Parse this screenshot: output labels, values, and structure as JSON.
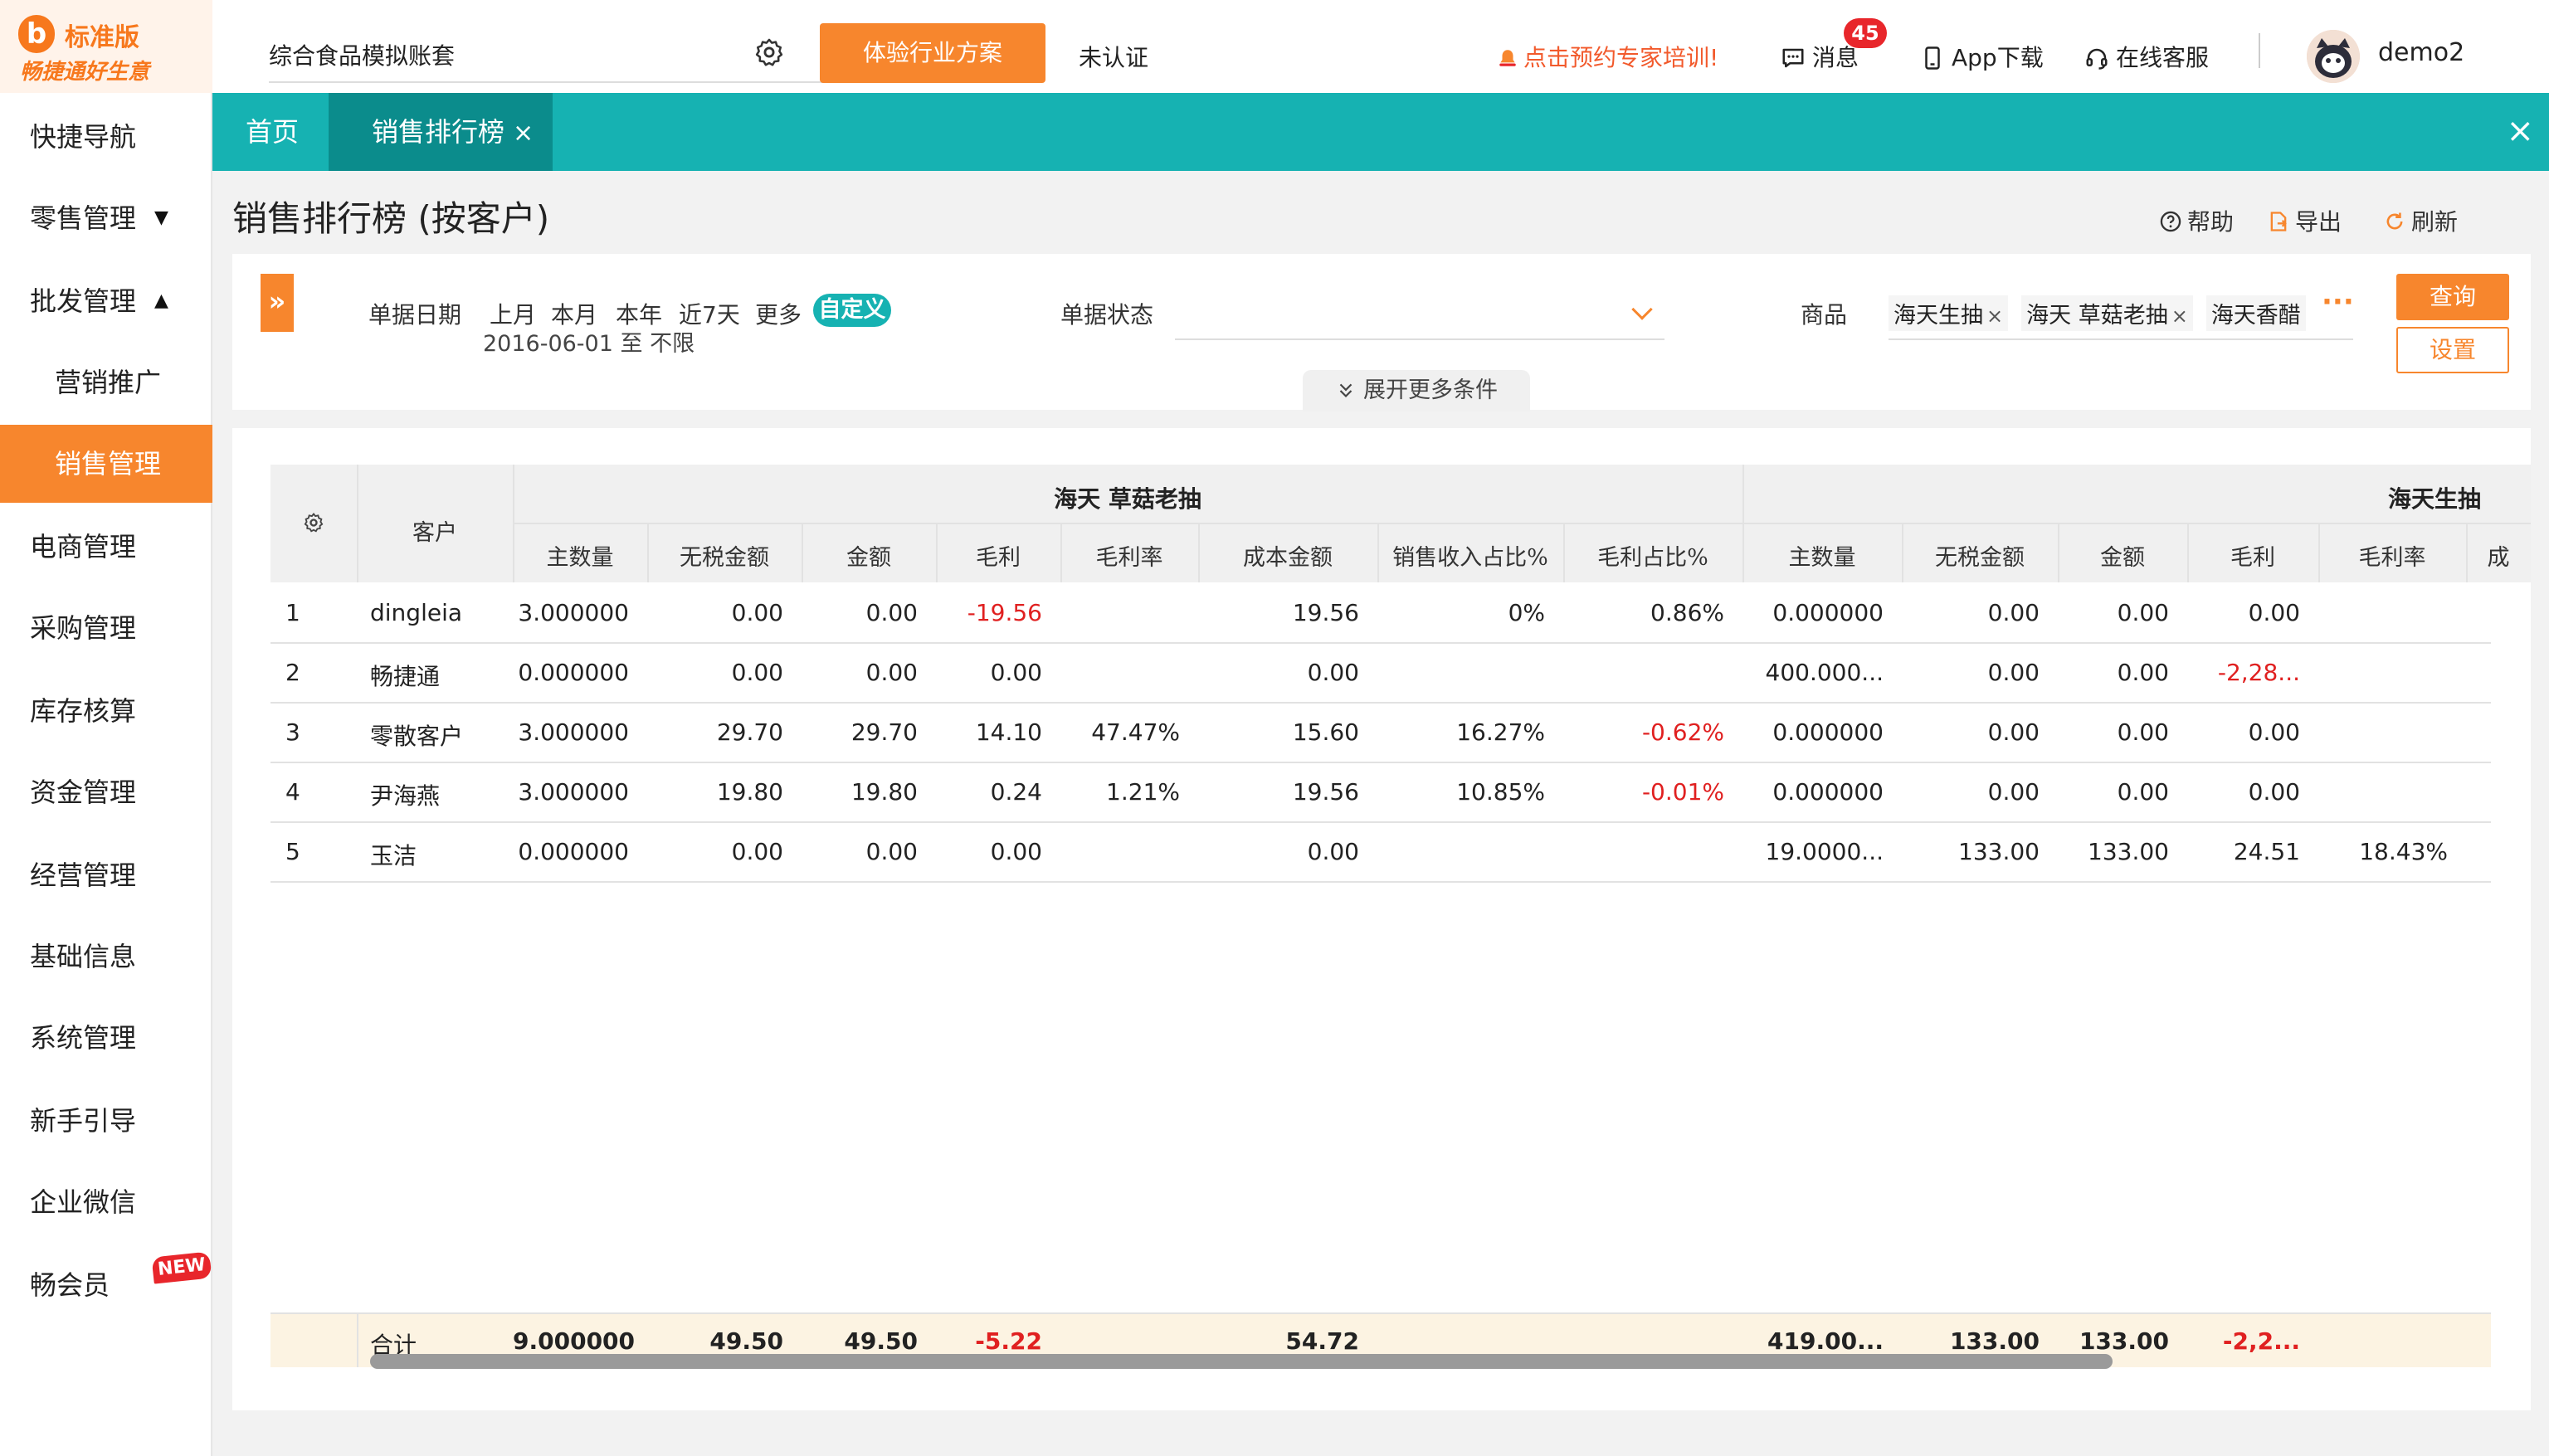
{
  "brand": {
    "logo_letter": "b",
    "edition": "标准版",
    "slogan": "畅捷通好生意"
  },
  "sidebar": {
    "items": [
      {
        "label": "快捷导航",
        "caret": ""
      },
      {
        "label": "零售管理",
        "caret": "▼"
      },
      {
        "label": "批发管理",
        "caret": "▲"
      },
      {
        "label": "营销推广",
        "caret": ""
      },
      {
        "label": "销售管理",
        "caret": ""
      },
      {
        "label": "电商管理",
        "caret": ""
      },
      {
        "label": "采购管理",
        "caret": ""
      },
      {
        "label": "库存核算",
        "caret": ""
      },
      {
        "label": "资金管理",
        "caret": ""
      },
      {
        "label": "经营管理",
        "caret": ""
      },
      {
        "label": "基础信息",
        "caret": ""
      },
      {
        "label": "系统管理",
        "caret": ""
      },
      {
        "label": "新手引导",
        "caret": ""
      },
      {
        "label": "企业微信",
        "caret": ""
      },
      {
        "label": "畅会员",
        "caret": ""
      }
    ],
    "new_badge": "NEW"
  },
  "header": {
    "account": "综合食品模拟账套",
    "trial_button": "体验行业方案",
    "verify_status": "未认证",
    "expert_link": "点击预约专家培训!",
    "messages_label": "消息",
    "messages_count": "45",
    "app_download": "App下载",
    "online_service": "在线客服",
    "username": "demo2"
  },
  "tabs": {
    "home": "首页",
    "current": "销售排行榜",
    "close_symbol": "×",
    "close_all": "×"
  },
  "page": {
    "title": "销售排行榜 (按客户)",
    "help": "帮助",
    "export": "导出",
    "refresh": "刷新"
  },
  "filters": {
    "toggle": "»",
    "date_label": "单据日期",
    "quick_dates": [
      "上月",
      "本月",
      "本年",
      "近7天",
      "更多"
    ],
    "custom": "自定义",
    "date_range": "2016-06-01 至 不限",
    "status_label": "单据状态",
    "status_value": "",
    "product_label": "商品",
    "product_chips": [
      "海天生抽",
      "海天 草菇老抽",
      "海天香醋"
    ],
    "more_dots": "···",
    "query": "查询",
    "settings": "设置",
    "expand_more": "展开更多条件"
  },
  "table": {
    "customer_header": "客户",
    "groups": [
      "海天 草菇老抽",
      "海天生抽"
    ],
    "columns_g1": [
      "主数量",
      "无税金额",
      "金额",
      "毛利",
      "毛利率",
      "成本金额",
      "销售收入占比%",
      "毛利占比%"
    ],
    "columns_g2": [
      "主数量",
      "无税金额",
      "金额",
      "毛利",
      "毛利率",
      "成"
    ],
    "rows": [
      {
        "idx": "1",
        "customer": "dingleia",
        "g1": [
          "3.000000",
          "0.00",
          "0.00",
          "-19.56",
          "",
          "19.56",
          "0%",
          "0.86%"
        ],
        "g2": [
          "0.000000",
          "0.00",
          "0.00",
          "0.00",
          ""
        ]
      },
      {
        "idx": "2",
        "customer": "畅捷通",
        "g1": [
          "0.000000",
          "0.00",
          "0.00",
          "0.00",
          "",
          "0.00",
          "",
          ""
        ],
        "g2": [
          "400.000...",
          "0.00",
          "0.00",
          "-2,28...",
          ""
        ]
      },
      {
        "idx": "3",
        "customer": "零散客户",
        "g1": [
          "3.000000",
          "29.70",
          "29.70",
          "14.10",
          "47.47%",
          "15.60",
          "16.27%",
          "-0.62%"
        ],
        "g2": [
          "0.000000",
          "0.00",
          "0.00",
          "0.00",
          ""
        ]
      },
      {
        "idx": "4",
        "customer": "尹海燕",
        "g1": [
          "3.000000",
          "19.80",
          "19.80",
          "0.24",
          "1.21%",
          "19.56",
          "10.85%",
          "-0.01%"
        ],
        "g2": [
          "0.000000",
          "0.00",
          "0.00",
          "0.00",
          ""
        ]
      },
      {
        "idx": "5",
        "customer": "玉洁",
        "g1": [
          "0.000000",
          "0.00",
          "0.00",
          "0.00",
          "",
          "0.00",
          "",
          ""
        ],
        "g2": [
          "19.0000...",
          "133.00",
          "133.00",
          "24.51",
          "18.43%"
        ]
      }
    ],
    "total": {
      "label": "合计",
      "g1": [
        "9.000000",
        "49.50",
        "49.50",
        "-5.22",
        "",
        "54.72",
        "",
        ""
      ],
      "g2": [
        "419.00...",
        "133.00",
        "133.00",
        "-2,2...",
        ""
      ]
    }
  },
  "colors": {
    "accent": "#f7862d",
    "teal": "#16b2b2",
    "negative": "#e02020"
  }
}
